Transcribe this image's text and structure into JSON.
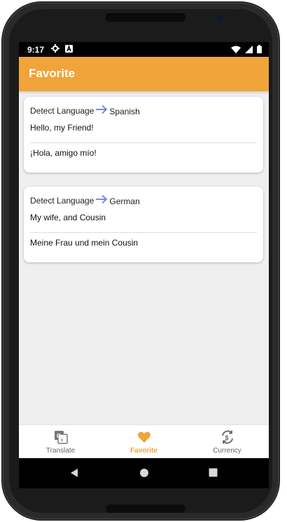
{
  "status_bar": {
    "time": "9:17",
    "left_icons": [
      "gear-icon",
      "a-badge-icon"
    ],
    "right_icons": [
      "wifi-icon",
      "signal-icon",
      "battery-icon"
    ]
  },
  "app_bar": {
    "title": "Favorite",
    "color": "#f0a43a"
  },
  "favorites": [
    {
      "source_language": "Detect Language",
      "target_language": "Spanish",
      "source_text": "Hello, my Friend!",
      "translated_text": "¡Hola, amigo mío!"
    },
    {
      "source_language": "Detect Language",
      "target_language": "German",
      "source_text": "My wife, and Cousin",
      "translated_text": "Meine Frau und mein Cousin"
    }
  ],
  "bottom_nav": {
    "items": [
      {
        "label": "Translate",
        "icon": "translate-icon",
        "active": false
      },
      {
        "label": "Favorite",
        "icon": "heart-icon",
        "active": true
      },
      {
        "label": "Currency",
        "icon": "currency-exchange-icon",
        "active": false
      }
    ],
    "active_color": "#f0a43a"
  },
  "system_nav": {
    "icons": [
      "back-icon",
      "home-icon",
      "recents-icon"
    ]
  }
}
